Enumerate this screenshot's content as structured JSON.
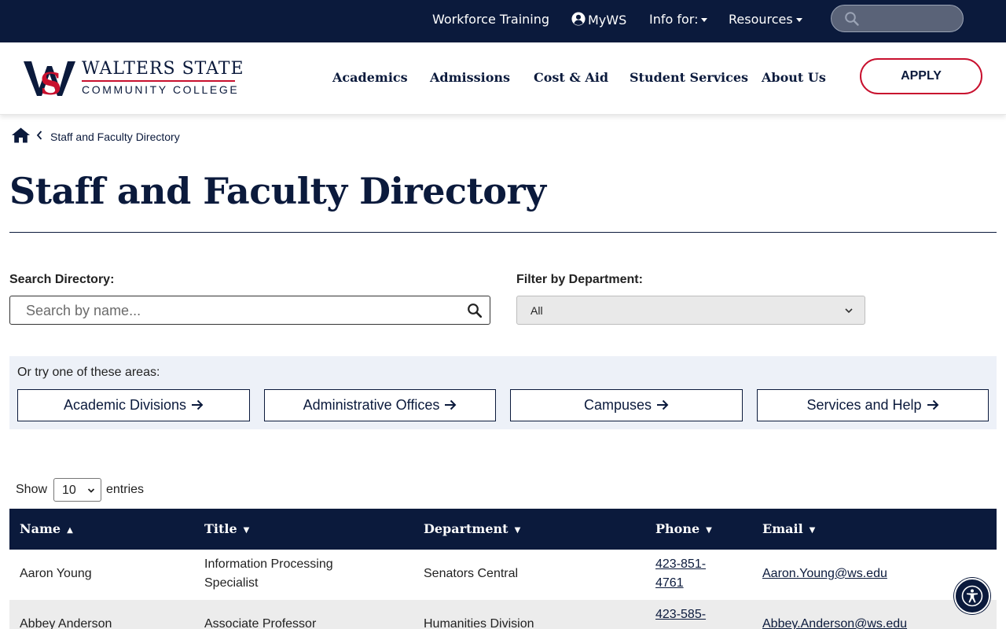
{
  "topbar": {
    "workforce": "Workforce Training",
    "myws": "MyWS",
    "info_for": "Info for:",
    "resources": "Resources"
  },
  "logo": {
    "name": "WALTERS STATE",
    "sub": "COMMUNITY COLLEGE"
  },
  "nav": {
    "academics": "Academics",
    "admissions": "Admissions",
    "cost_aid": "Cost & Aid",
    "student_services": "Student Services",
    "about": "About Us",
    "apply": "APPLY"
  },
  "breadcrumb": {
    "current": "Staff and Faculty Directory"
  },
  "page": {
    "title": "Staff and Faculty Directory"
  },
  "filters": {
    "search_label": "Search Directory:",
    "search_placeholder": "Search by name...",
    "dept_label": "Filter by Department:",
    "dept_value": "All"
  },
  "areas": {
    "label": "Or try one of these areas:",
    "academic": "Academic Divisions",
    "admin": "Administrative Offices",
    "campuses": "Campuses",
    "services": "Services and Help"
  },
  "entries": {
    "show": "Show",
    "value": "10",
    "suffix": "entries"
  },
  "table": {
    "headers": {
      "name": "Name",
      "title": "Title",
      "department": "Department",
      "phone": "Phone",
      "email": "Email"
    },
    "rows": [
      {
        "name": "Aaron Young",
        "title_l1": "Information Processing",
        "title_l2": "Specialist",
        "department": "Senators Central",
        "phone_l1": "423-851-",
        "phone_l2": "4761",
        "email": "Aaron.Young@ws.edu"
      },
      {
        "name": "Abbey Anderson",
        "title_l1": "Associate Professor",
        "department": "Humanities Division",
        "phone_l1": "423-585-",
        "email": "Abbey.Anderson@ws.edu"
      }
    ]
  },
  "colors": {
    "navy": "#0b1a3c",
    "red": "#c8102e",
    "area_bg": "#edf1f8",
    "row_alt": "#ececec"
  },
  "icons": {
    "top_search": "search-icon",
    "user": "user-circle-icon",
    "home": "home-icon",
    "accessibility": "accessibility-icon"
  }
}
